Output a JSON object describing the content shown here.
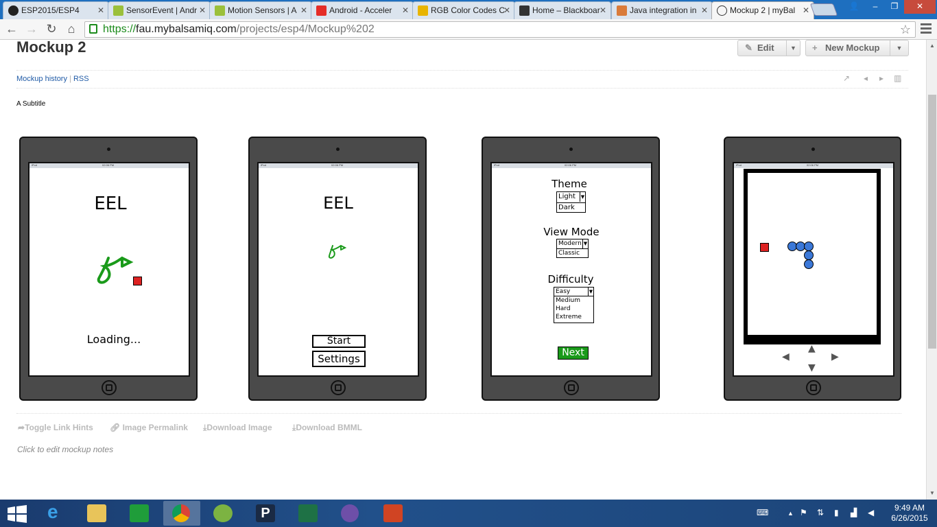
{
  "browser": {
    "tabs": [
      {
        "label": "ESP2015/ESP4",
        "color": "#222222",
        "active": false
      },
      {
        "label": "SensorEvent | Andr",
        "color": "#9bc03b",
        "active": false
      },
      {
        "label": "Motion Sensors | A",
        "color": "#9bc03b",
        "active": false
      },
      {
        "label": "Android - Acceler",
        "color": "#e52d27",
        "active": false
      },
      {
        "label": "RGB Color Codes C",
        "color": "#e8b400",
        "active": false
      },
      {
        "label": "Home – Blackboar",
        "color": "#333333",
        "active": false
      },
      {
        "label": "Java integration in",
        "color": "#d97b3a",
        "active": false
      },
      {
        "label": "Mockup 2 | myBal",
        "color": "#ffffff",
        "active": true
      }
    ],
    "url_scheme": "https://",
    "url_host": "fau.mybalsamiq.com",
    "url_path": "/projects/esp4/Mockup%202"
  },
  "page": {
    "title": "Mockup 2",
    "edit_label": "Edit",
    "new_mockup_label": "New Mockup",
    "mockup_history_label": "Mockup history",
    "rss_label": "RSS",
    "subtitle": "A Subtitle",
    "footer_links": [
      "Toggle Link Hints",
      "Image Permalink",
      "Download Image",
      "Download BMML"
    ],
    "notes_placeholder": "Click to edit mockup notes"
  },
  "mockups": {
    "status_carrier": "iPod",
    "status_time": "02:06 PM",
    "screen1": {
      "app_title": "EEL",
      "loading_text": "Loading..."
    },
    "screen2": {
      "app_title": "EEL",
      "start_label": "Start",
      "settings_label": "Settings"
    },
    "screen3": {
      "theme_label": "Theme",
      "theme_options": [
        "Light",
        "Dark"
      ],
      "view_mode_label": "View Mode",
      "view_mode_options": [
        "Modern",
        "Classic"
      ],
      "difficulty_label": "Difficulty",
      "difficulty_options": [
        "Easy",
        "Medium",
        "Hard",
        "Extreme"
      ],
      "next_label": "Next"
    },
    "screen4": {
      "controls": [
        "◀",
        "▲",
        "▶",
        "▼"
      ]
    },
    "colors": {
      "eel_green": "#1a9a1a",
      "food_red": "#dd2222",
      "snake_blue": "#3b78d8",
      "next_green": "#1a9a1a"
    }
  },
  "taskbar": {
    "time": "9:49 AM",
    "date": "6/26/2015"
  }
}
